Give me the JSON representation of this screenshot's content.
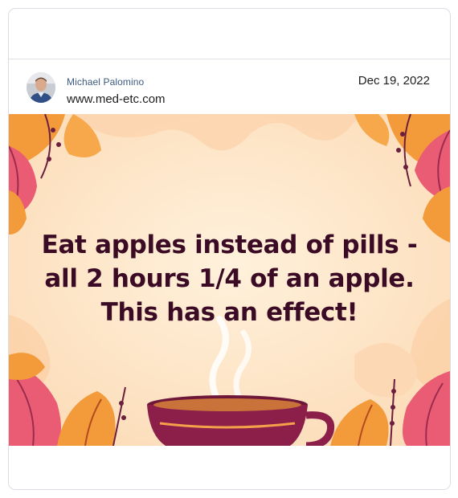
{
  "post": {
    "author_name": "Michael Palomino",
    "site_url": "www.med-etc.com",
    "date": "Dec 19, 2022",
    "image_text": [
      "Eat apples instead of pills -",
      "all 2 hours 1/4 of an apple.",
      "This has an effect!"
    ]
  },
  "icons": {
    "avatar": "author-avatar-photo"
  },
  "colors": {
    "author_name": "#3d5a80",
    "image_text": "#3b0a24",
    "image_background": "#fde2c1",
    "leaf_orange": "#f08a2a",
    "leaf_pink": "#e8516a",
    "cup": "#8c1f4a"
  }
}
